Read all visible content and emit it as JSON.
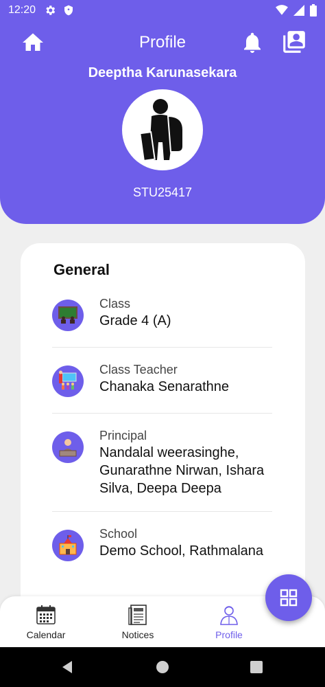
{
  "status_bar": {
    "time": "12:20",
    "left_icons": [
      "gear-icon",
      "shield-icon"
    ],
    "right_icons": [
      "wifi-icon",
      "signal-icon",
      "battery-icon"
    ]
  },
  "header": {
    "title": "Profile",
    "student_name": "Deeptha Karunasekara",
    "student_id": "STU25417",
    "icons": [
      "home-icon",
      "bell-icon",
      "contacts-icon"
    ],
    "color": "#6e5eea"
  },
  "general": {
    "heading": "General",
    "items": [
      {
        "label": "Class",
        "value": "Grade 4 (A)",
        "icon": "classroom-icon"
      },
      {
        "label": "Class Teacher",
        "value": "Chanaka Senarathne",
        "icon": "teacher-icon"
      },
      {
        "label": "Principal",
        "value": "Nandalal weerasinghe, Gunarathne Nirwan, Ishara Silva, Deepa Deepa",
        "icon": "principal-icon"
      },
      {
        "label": "School",
        "value": "Demo School, Rathmalana",
        "icon": "school-building-icon"
      }
    ]
  },
  "fab": {
    "icon": "grid-icon"
  },
  "bottom_nav": {
    "items": [
      {
        "label": "Calendar",
        "icon": "calendar-icon",
        "active": false
      },
      {
        "label": "Notices",
        "icon": "notices-icon",
        "active": false
      },
      {
        "label": "Profile",
        "icon": "profile-icon",
        "active": true
      }
    ]
  },
  "system_nav": [
    "back-icon",
    "home-circle-icon",
    "recents-icon"
  ]
}
